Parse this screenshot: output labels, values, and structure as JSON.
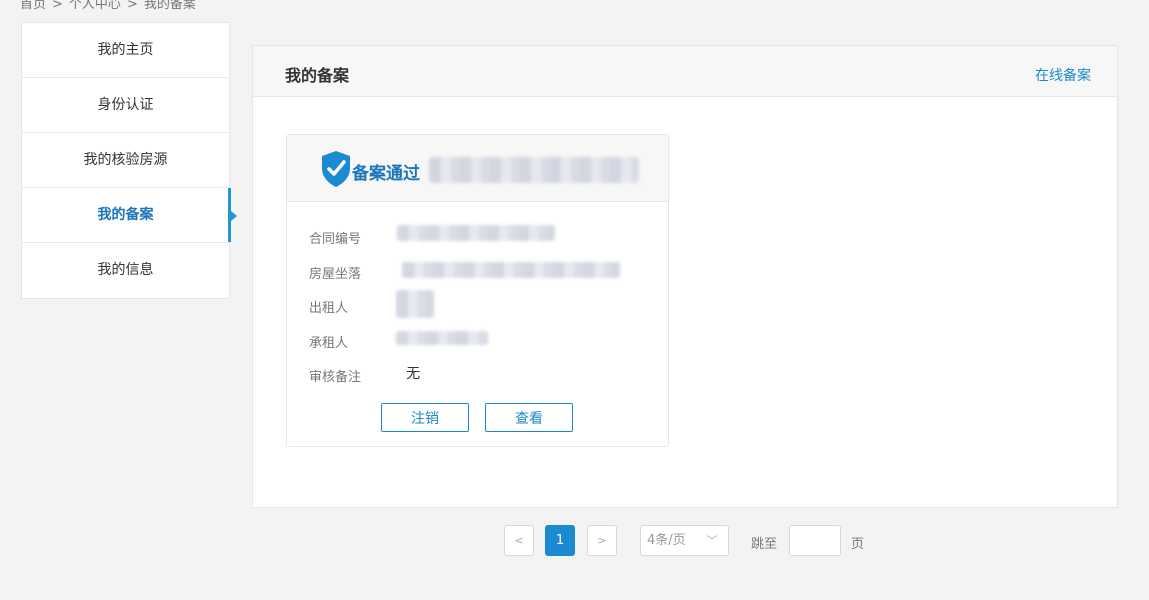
{
  "breadcrumb": {
    "items": [
      "首页",
      "个人中心",
      "我的备案"
    ],
    "separator": ">"
  },
  "sidebar": {
    "items": [
      {
        "label": "我的主页"
      },
      {
        "label": "身份认证"
      },
      {
        "label": "我的核验房源"
      },
      {
        "label": "我的备案",
        "active": true
      },
      {
        "label": "我的信息"
      }
    ]
  },
  "panel": {
    "title": "我的备案",
    "link": "在线备案"
  },
  "card": {
    "status": "备案通过",
    "rows": [
      {
        "label": "合同编号",
        "value": ""
      },
      {
        "label": "房屋坐落",
        "value": ""
      },
      {
        "label": "出租人",
        "value": ""
      },
      {
        "label": "承租人",
        "value": ""
      },
      {
        "label": "审核备注",
        "value": "无"
      }
    ],
    "buttons": {
      "cancel": "注销",
      "view": "查看"
    }
  },
  "pagination": {
    "prev": "<",
    "next": ">",
    "current": "1",
    "page_size": "4条/页",
    "jump_label": "跳至",
    "page_unit": "页",
    "jump_value": ""
  },
  "colors": {
    "accent": "#1a8bc8",
    "active": "#1a75bb",
    "current_page": "#1a8bd3"
  }
}
